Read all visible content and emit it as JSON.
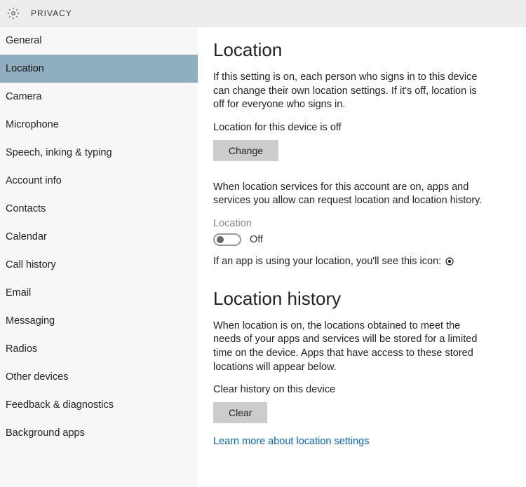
{
  "header": {
    "title": "PRIVACY"
  },
  "sidebar": {
    "items": [
      {
        "label": "General",
        "selected": false
      },
      {
        "label": "Location",
        "selected": true
      },
      {
        "label": "Camera",
        "selected": false
      },
      {
        "label": "Microphone",
        "selected": false
      },
      {
        "label": "Speech, inking & typing",
        "selected": false
      },
      {
        "label": "Account info",
        "selected": false
      },
      {
        "label": "Contacts",
        "selected": false
      },
      {
        "label": "Calendar",
        "selected": false
      },
      {
        "label": "Call history",
        "selected": false
      },
      {
        "label": "Email",
        "selected": false
      },
      {
        "label": "Messaging",
        "selected": false
      },
      {
        "label": "Radios",
        "selected": false
      },
      {
        "label": "Other devices",
        "selected": false
      },
      {
        "label": "Feedback & diagnostics",
        "selected": false
      },
      {
        "label": "Background apps",
        "selected": false
      }
    ]
  },
  "main": {
    "location_heading": "Location",
    "location_desc": "If this setting is on, each person who signs in to this device can change their own location settings. If it's off, location is off for everyone who signs in.",
    "device_status": "Location for this device is off",
    "change_btn": "Change",
    "account_desc": "When location services for this account are on, apps and services you allow can request location and location history.",
    "toggle_label": "Location",
    "toggle_state": "Off",
    "app_icon_line": "If an app is using your location, you'll see this icon:",
    "history_heading": "Location history",
    "history_desc": "When location is on, the locations obtained to meet the needs of your apps and services will be stored for a limited time on the device. Apps that have access to these stored locations will appear below.",
    "clear_label": "Clear history on this device",
    "clear_btn": "Clear",
    "learn_more_link": "Learn more about location settings"
  }
}
